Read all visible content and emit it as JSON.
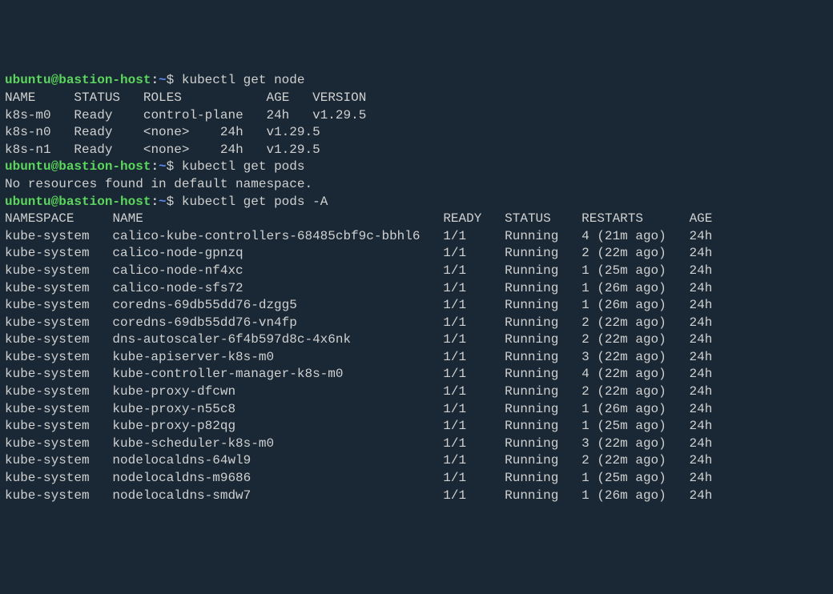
{
  "prompt": {
    "user_host": "ubuntu@bastion-host",
    "path": "~",
    "dollar": "$"
  },
  "commands": {
    "get_node": "kubectl get node",
    "get_pods": "kubectl get pods",
    "get_pods_a": "kubectl get pods -A",
    "no_resources": "No resources found in default namespace."
  },
  "nodes": {
    "header": {
      "name": "NAME",
      "status": "STATUS",
      "roles": "ROLES",
      "age": "AGE",
      "version": "VERSION"
    },
    "rows": [
      {
        "name": "k8s-m0",
        "status": "Ready",
        "roles": "control-plane",
        "age": "24h",
        "version": "v1.29.5"
      },
      {
        "name": "k8s-n0",
        "status": "Ready",
        "roles": "<none>",
        "age": "24h",
        "version": "v1.29.5"
      },
      {
        "name": "k8s-n1",
        "status": "Ready",
        "roles": "<none>",
        "age": "24h",
        "version": "v1.29.5"
      }
    ]
  },
  "pods": {
    "header": {
      "namespace": "NAMESPACE",
      "name": "NAME",
      "ready": "READY",
      "status": "STATUS",
      "restarts": "RESTARTS",
      "age": "AGE"
    },
    "rows": [
      {
        "namespace": "kube-system",
        "name": "calico-kube-controllers-68485cbf9c-bbhl6",
        "ready": "1/1",
        "status": "Running",
        "restarts": "4 (21m ago)",
        "age": "24h"
      },
      {
        "namespace": "kube-system",
        "name": "calico-node-gpnzq",
        "ready": "1/1",
        "status": "Running",
        "restarts": "2 (22m ago)",
        "age": "24h"
      },
      {
        "namespace": "kube-system",
        "name": "calico-node-nf4xc",
        "ready": "1/1",
        "status": "Running",
        "restarts": "1 (25m ago)",
        "age": "24h"
      },
      {
        "namespace": "kube-system",
        "name": "calico-node-sfs72",
        "ready": "1/1",
        "status": "Running",
        "restarts": "1 (26m ago)",
        "age": "24h"
      },
      {
        "namespace": "kube-system",
        "name": "coredns-69db55dd76-dzgg5",
        "ready": "1/1",
        "status": "Running",
        "restarts": "1 (26m ago)",
        "age": "24h"
      },
      {
        "namespace": "kube-system",
        "name": "coredns-69db55dd76-vn4fp",
        "ready": "1/1",
        "status": "Running",
        "restarts": "2 (22m ago)",
        "age": "24h"
      },
      {
        "namespace": "kube-system",
        "name": "dns-autoscaler-6f4b597d8c-4x6nk",
        "ready": "1/1",
        "status": "Running",
        "restarts": "2 (22m ago)",
        "age": "24h"
      },
      {
        "namespace": "kube-system",
        "name": "kube-apiserver-k8s-m0",
        "ready": "1/1",
        "status": "Running",
        "restarts": "3 (22m ago)",
        "age": "24h"
      },
      {
        "namespace": "kube-system",
        "name": "kube-controller-manager-k8s-m0",
        "ready": "1/1",
        "status": "Running",
        "restarts": "4 (22m ago)",
        "age": "24h"
      },
      {
        "namespace": "kube-system",
        "name": "kube-proxy-dfcwn",
        "ready": "1/1",
        "status": "Running",
        "restarts": "2 (22m ago)",
        "age": "24h"
      },
      {
        "namespace": "kube-system",
        "name": "kube-proxy-n55c8",
        "ready": "1/1",
        "status": "Running",
        "restarts": "1 (26m ago)",
        "age": "24h"
      },
      {
        "namespace": "kube-system",
        "name": "kube-proxy-p82qg",
        "ready": "1/1",
        "status": "Running",
        "restarts": "1 (25m ago)",
        "age": "24h"
      },
      {
        "namespace": "kube-system",
        "name": "kube-scheduler-k8s-m0",
        "ready": "1/1",
        "status": "Running",
        "restarts": "3 (22m ago)",
        "age": "24h"
      },
      {
        "namespace": "kube-system",
        "name": "nodelocaldns-64wl9",
        "ready": "1/1",
        "status": "Running",
        "restarts": "2 (22m ago)",
        "age": "24h"
      },
      {
        "namespace": "kube-system",
        "name": "nodelocaldns-m9686",
        "ready": "1/1",
        "status": "Running",
        "restarts": "1 (25m ago)",
        "age": "24h"
      },
      {
        "namespace": "kube-system",
        "name": "nodelocaldns-smdw7",
        "ready": "1/1",
        "status": "Running",
        "restarts": "1 (26m ago)",
        "age": "24h"
      }
    ]
  }
}
